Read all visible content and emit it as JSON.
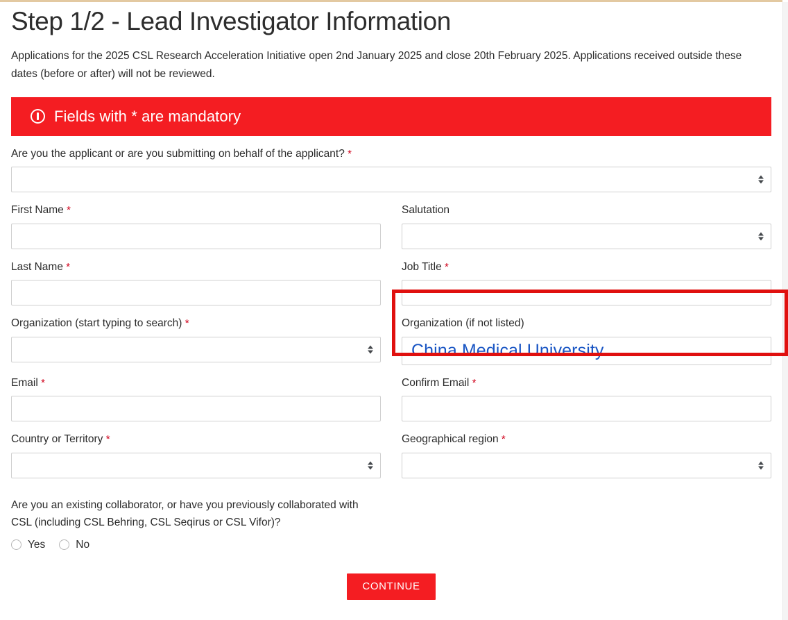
{
  "page": {
    "title": "Step 1/2 - Lead Investigator Information",
    "intro": "Applications for the 2025 CSL Research Acceleration Initiative open 2nd January 2025 and close 20th February 2025. Applications received outside these dates (before or after) will not be reviewed."
  },
  "banner": {
    "icon": "exclamation-circle-icon",
    "text": "Fields with * are mandatory",
    "background_color": "#f41d22",
    "text_color": "#ffffff"
  },
  "form": {
    "applicant_role": {
      "label": "Are you the applicant or are you submitting on behalf of the applicant?",
      "required_marker": "*",
      "value": "",
      "control": "select"
    },
    "first_name": {
      "label": "First Name",
      "required_marker": "*",
      "value": "",
      "control": "text"
    },
    "salutation": {
      "label": "Salutation",
      "required_marker": "",
      "value": "",
      "control": "select"
    },
    "last_name": {
      "label": "Last Name",
      "required_marker": "*",
      "value": "",
      "control": "text"
    },
    "job_title": {
      "label": "Job Title",
      "required_marker": "*",
      "value": "",
      "control": "text"
    },
    "organization_search": {
      "label": "Organization (start typing to search)",
      "required_marker": "*",
      "value": "",
      "control": "select"
    },
    "organization_other": {
      "label": "Organization (if not listed)",
      "required_marker": "",
      "value": "China Medical University",
      "value_color": "#1a56c4",
      "control": "text",
      "highlighted": true
    },
    "email": {
      "label": "Email",
      "required_marker": "*",
      "value": "",
      "control": "text"
    },
    "confirm_email": {
      "label": "Confirm Email",
      "required_marker": "*",
      "value": "",
      "control": "text"
    },
    "country": {
      "label": "Country or Territory",
      "required_marker": "*",
      "value": "",
      "control": "select"
    },
    "geographical_region": {
      "label": "Geographical region",
      "required_marker": "*",
      "value": "",
      "control": "select"
    },
    "collaborator": {
      "question": "Are you an existing collaborator, or have you previously collaborated with CSL (including CSL Behring, CSL Seqirus or CSL Vifor)?",
      "options": [
        {
          "label": "Yes",
          "selected": false
        },
        {
          "label": "No",
          "selected": false
        }
      ]
    }
  },
  "actions": {
    "continue_label": "CONTINUE",
    "continue_color": "#f41d22"
  },
  "colors": {
    "accent_red": "#f41d22",
    "required_red": "#d0021b",
    "highlight_red": "#e0100f",
    "typed_blue": "#1a56c4",
    "top_rule": "#e3c9a1",
    "input_border": "#cfcfcf"
  }
}
